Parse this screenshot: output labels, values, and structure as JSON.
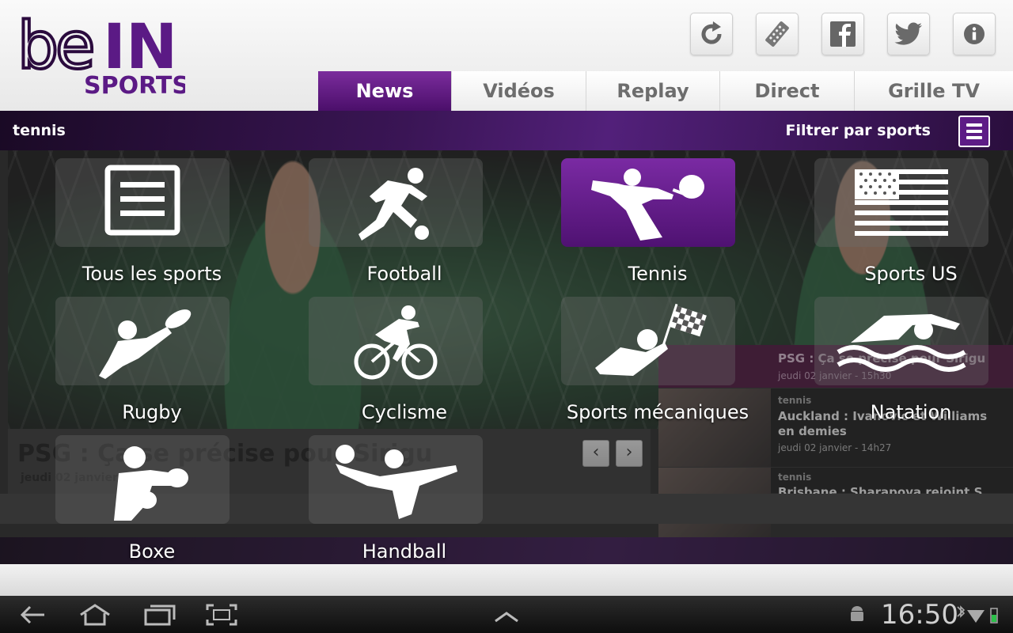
{
  "header": {
    "logo_text": "beIN SPORTS",
    "buttons": [
      {
        "name": "refresh-icon"
      },
      {
        "name": "remote-icon"
      },
      {
        "name": "facebook-icon"
      },
      {
        "name": "twitter-icon"
      },
      {
        "name": "info-icon"
      }
    ]
  },
  "tabs": [
    {
      "label": "News",
      "active": true
    },
    {
      "label": "Vidéos",
      "active": false
    },
    {
      "label": "Replay",
      "active": false
    },
    {
      "label": "Direct",
      "active": false
    },
    {
      "label": "Grille TV",
      "active": false
    }
  ],
  "filter": {
    "current": "tennis",
    "label": "Filtrer par sports"
  },
  "article": {
    "title": "PSG : Ça se précise pour Sirigu",
    "date": "jeudi 02 janvier"
  },
  "side_list": [
    {
      "sport": "",
      "title": "PSG : Ça se précise pour Sirigu",
      "date": "jeudi 02 janvier - 15h30"
    },
    {
      "sport": "tennis",
      "title": "Auckland : Ivanovic et Williams en demies",
      "date": "jeudi 02 janvier - 14h27"
    },
    {
      "sport": "tennis",
      "title": "Brisbane : Sharapova rejoint S...",
      "date": ""
    }
  ],
  "sports_menu": [
    {
      "label": "Tous les sports",
      "icon": "list-icon",
      "active": false
    },
    {
      "label": "Football",
      "icon": "football-icon",
      "active": false
    },
    {
      "label": "Tennis",
      "icon": "tennis-icon",
      "active": true
    },
    {
      "label": "Sports US",
      "icon": "us-flag-icon",
      "active": false
    },
    {
      "label": "Rugby",
      "icon": "rugby-icon",
      "active": false
    },
    {
      "label": "Cyclisme",
      "icon": "cycling-icon",
      "active": false
    },
    {
      "label": "Sports mécaniques",
      "icon": "motorsport-icon",
      "active": false
    },
    {
      "label": "Natation",
      "icon": "swimming-icon",
      "active": false
    },
    {
      "label": "Boxe",
      "icon": "boxing-icon",
      "active": false
    },
    {
      "label": "Handball",
      "icon": "handball-icon",
      "active": false
    }
  ],
  "system_bar": {
    "clock": "16:50",
    "nav": [
      "back-icon",
      "home-icon",
      "recent-apps-icon",
      "screenshot-icon",
      "menu-up-icon"
    ]
  },
  "colors": {
    "brand_purple": "#5b1a85",
    "tab_active": "#6a2391"
  }
}
